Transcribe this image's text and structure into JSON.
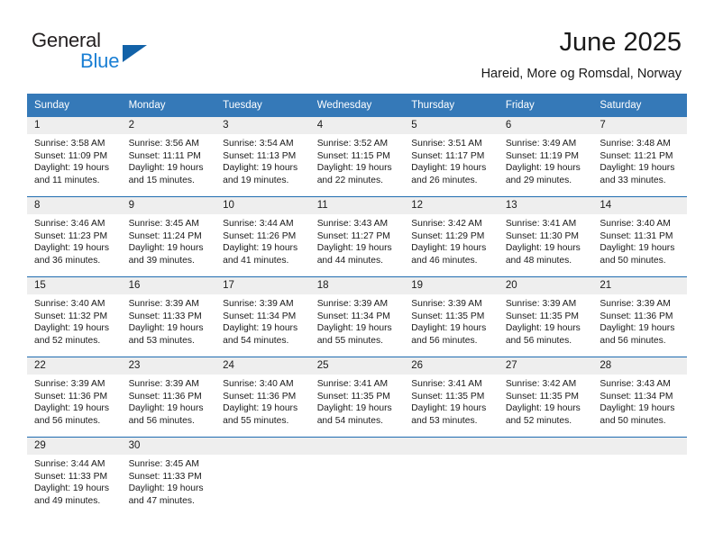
{
  "brand": {
    "name_part1": "General",
    "name_part2": "Blue",
    "triangle_color": "#1262a8",
    "blue_color": "#1a7fd4"
  },
  "header": {
    "title": "June 2025",
    "subtitle": "Hareid, More og Romsdal, Norway"
  },
  "theme": {
    "header_bg": "#3579b8",
    "row_divider": "#1f6cb0",
    "daynum_bg": "#eeeeee"
  },
  "weekday_headers": [
    "Sunday",
    "Monday",
    "Tuesday",
    "Wednesday",
    "Thursday",
    "Friday",
    "Saturday"
  ],
  "weeks": [
    [
      {
        "day": "1",
        "sunrise": "Sunrise: 3:58 AM",
        "sunset": "Sunset: 11:09 PM",
        "daylight_line1": "Daylight: 19 hours",
        "daylight_line2": "and 11 minutes."
      },
      {
        "day": "2",
        "sunrise": "Sunrise: 3:56 AM",
        "sunset": "Sunset: 11:11 PM",
        "daylight_line1": "Daylight: 19 hours",
        "daylight_line2": "and 15 minutes."
      },
      {
        "day": "3",
        "sunrise": "Sunrise: 3:54 AM",
        "sunset": "Sunset: 11:13 PM",
        "daylight_line1": "Daylight: 19 hours",
        "daylight_line2": "and 19 minutes."
      },
      {
        "day": "4",
        "sunrise": "Sunrise: 3:52 AM",
        "sunset": "Sunset: 11:15 PM",
        "daylight_line1": "Daylight: 19 hours",
        "daylight_line2": "and 22 minutes."
      },
      {
        "day": "5",
        "sunrise": "Sunrise: 3:51 AM",
        "sunset": "Sunset: 11:17 PM",
        "daylight_line1": "Daylight: 19 hours",
        "daylight_line2": "and 26 minutes."
      },
      {
        "day": "6",
        "sunrise": "Sunrise: 3:49 AM",
        "sunset": "Sunset: 11:19 PM",
        "daylight_line1": "Daylight: 19 hours",
        "daylight_line2": "and 29 minutes."
      },
      {
        "day": "7",
        "sunrise": "Sunrise: 3:48 AM",
        "sunset": "Sunset: 11:21 PM",
        "daylight_line1": "Daylight: 19 hours",
        "daylight_line2": "and 33 minutes."
      }
    ],
    [
      {
        "day": "8",
        "sunrise": "Sunrise: 3:46 AM",
        "sunset": "Sunset: 11:23 PM",
        "daylight_line1": "Daylight: 19 hours",
        "daylight_line2": "and 36 minutes."
      },
      {
        "day": "9",
        "sunrise": "Sunrise: 3:45 AM",
        "sunset": "Sunset: 11:24 PM",
        "daylight_line1": "Daylight: 19 hours",
        "daylight_line2": "and 39 minutes."
      },
      {
        "day": "10",
        "sunrise": "Sunrise: 3:44 AM",
        "sunset": "Sunset: 11:26 PM",
        "daylight_line1": "Daylight: 19 hours",
        "daylight_line2": "and 41 minutes."
      },
      {
        "day": "11",
        "sunrise": "Sunrise: 3:43 AM",
        "sunset": "Sunset: 11:27 PM",
        "daylight_line1": "Daylight: 19 hours",
        "daylight_line2": "and 44 minutes."
      },
      {
        "day": "12",
        "sunrise": "Sunrise: 3:42 AM",
        "sunset": "Sunset: 11:29 PM",
        "daylight_line1": "Daylight: 19 hours",
        "daylight_line2": "and 46 minutes."
      },
      {
        "day": "13",
        "sunrise": "Sunrise: 3:41 AM",
        "sunset": "Sunset: 11:30 PM",
        "daylight_line1": "Daylight: 19 hours",
        "daylight_line2": "and 48 minutes."
      },
      {
        "day": "14",
        "sunrise": "Sunrise: 3:40 AM",
        "sunset": "Sunset: 11:31 PM",
        "daylight_line1": "Daylight: 19 hours",
        "daylight_line2": "and 50 minutes."
      }
    ],
    [
      {
        "day": "15",
        "sunrise": "Sunrise: 3:40 AM",
        "sunset": "Sunset: 11:32 PM",
        "daylight_line1": "Daylight: 19 hours",
        "daylight_line2": "and 52 minutes."
      },
      {
        "day": "16",
        "sunrise": "Sunrise: 3:39 AM",
        "sunset": "Sunset: 11:33 PM",
        "daylight_line1": "Daylight: 19 hours",
        "daylight_line2": "and 53 minutes."
      },
      {
        "day": "17",
        "sunrise": "Sunrise: 3:39 AM",
        "sunset": "Sunset: 11:34 PM",
        "daylight_line1": "Daylight: 19 hours",
        "daylight_line2": "and 54 minutes."
      },
      {
        "day": "18",
        "sunrise": "Sunrise: 3:39 AM",
        "sunset": "Sunset: 11:34 PM",
        "daylight_line1": "Daylight: 19 hours",
        "daylight_line2": "and 55 minutes."
      },
      {
        "day": "19",
        "sunrise": "Sunrise: 3:39 AM",
        "sunset": "Sunset: 11:35 PM",
        "daylight_line1": "Daylight: 19 hours",
        "daylight_line2": "and 56 minutes."
      },
      {
        "day": "20",
        "sunrise": "Sunrise: 3:39 AM",
        "sunset": "Sunset: 11:35 PM",
        "daylight_line1": "Daylight: 19 hours",
        "daylight_line2": "and 56 minutes."
      },
      {
        "day": "21",
        "sunrise": "Sunrise: 3:39 AM",
        "sunset": "Sunset: 11:36 PM",
        "daylight_line1": "Daylight: 19 hours",
        "daylight_line2": "and 56 minutes."
      }
    ],
    [
      {
        "day": "22",
        "sunrise": "Sunrise: 3:39 AM",
        "sunset": "Sunset: 11:36 PM",
        "daylight_line1": "Daylight: 19 hours",
        "daylight_line2": "and 56 minutes."
      },
      {
        "day": "23",
        "sunrise": "Sunrise: 3:39 AM",
        "sunset": "Sunset: 11:36 PM",
        "daylight_line1": "Daylight: 19 hours",
        "daylight_line2": "and 56 minutes."
      },
      {
        "day": "24",
        "sunrise": "Sunrise: 3:40 AM",
        "sunset": "Sunset: 11:36 PM",
        "daylight_line1": "Daylight: 19 hours",
        "daylight_line2": "and 55 minutes."
      },
      {
        "day": "25",
        "sunrise": "Sunrise: 3:41 AM",
        "sunset": "Sunset: 11:35 PM",
        "daylight_line1": "Daylight: 19 hours",
        "daylight_line2": "and 54 minutes."
      },
      {
        "day": "26",
        "sunrise": "Sunrise: 3:41 AM",
        "sunset": "Sunset: 11:35 PM",
        "daylight_line1": "Daylight: 19 hours",
        "daylight_line2": "and 53 minutes."
      },
      {
        "day": "27",
        "sunrise": "Sunrise: 3:42 AM",
        "sunset": "Sunset: 11:35 PM",
        "daylight_line1": "Daylight: 19 hours",
        "daylight_line2": "and 52 minutes."
      },
      {
        "day": "28",
        "sunrise": "Sunrise: 3:43 AM",
        "sunset": "Sunset: 11:34 PM",
        "daylight_line1": "Daylight: 19 hours",
        "daylight_line2": "and 50 minutes."
      }
    ],
    [
      {
        "day": "29",
        "sunrise": "Sunrise: 3:44 AM",
        "sunset": "Sunset: 11:33 PM",
        "daylight_line1": "Daylight: 19 hours",
        "daylight_line2": "and 49 minutes."
      },
      {
        "day": "30",
        "sunrise": "Sunrise: 3:45 AM",
        "sunset": "Sunset: 11:33 PM",
        "daylight_line1": "Daylight: 19 hours",
        "daylight_line2": "and 47 minutes."
      },
      {
        "day": "",
        "sunrise": "",
        "sunset": "",
        "daylight_line1": "",
        "daylight_line2": ""
      },
      {
        "day": "",
        "sunrise": "",
        "sunset": "",
        "daylight_line1": "",
        "daylight_line2": ""
      },
      {
        "day": "",
        "sunrise": "",
        "sunset": "",
        "daylight_line1": "",
        "daylight_line2": ""
      },
      {
        "day": "",
        "sunrise": "",
        "sunset": "",
        "daylight_line1": "",
        "daylight_line2": ""
      },
      {
        "day": "",
        "sunrise": "",
        "sunset": "",
        "daylight_line1": "",
        "daylight_line2": ""
      }
    ]
  ]
}
